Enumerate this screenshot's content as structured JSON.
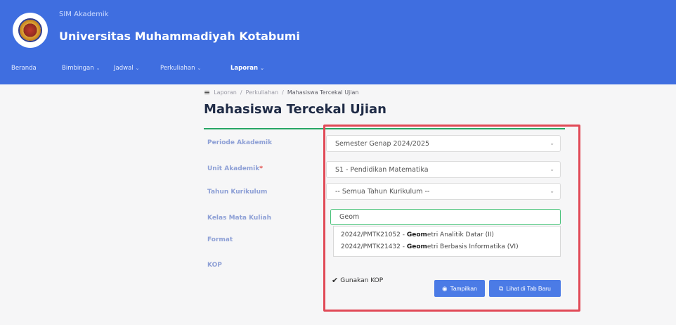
{
  "header": {
    "subtitle": "SIM Akademik",
    "title": "Universitas Muhammadiyah Kotabumi",
    "color": "#3f6ee0"
  },
  "nav": {
    "items": [
      {
        "label": "Beranda"
      },
      {
        "label": "Bimbingan"
      },
      {
        "label": "Jadwal"
      },
      {
        "label": "Perkuliahan"
      },
      {
        "label": "Laporan"
      }
    ]
  },
  "breadcrumb": {
    "items": [
      "Laporan",
      "Perkuliahan",
      "Mahasiswa Tercekal Ujian"
    ]
  },
  "page": {
    "title": "Mahasiswa Tercekal Ujian"
  },
  "form": {
    "periode": {
      "label": "Periode Akademik",
      "value": "Semester Genap 2024/2025"
    },
    "unit": {
      "label": "Unit Akademik",
      "required_mark": "*",
      "value": "S1 - Pendidikan Matematika"
    },
    "tahun": {
      "label": "Tahun Kurikulum",
      "value": "-- Semua Tahun Kurikulum --"
    },
    "kelas": {
      "label": "Kelas Mata Kuliah",
      "value": "Geom"
    },
    "format": {
      "label": "Format"
    },
    "kop": {
      "label": "KOP",
      "checkbox_label": "Gunakan KOP",
      "checked": true
    }
  },
  "dropdown": {
    "options": [
      {
        "prefix": "20242/PMTK21052 - ",
        "match": "Geom",
        "rest": "etri Analitik Datar (II)"
      },
      {
        "prefix": "20242/PMTK21432 - ",
        "match": "Geom",
        "rest": "etri Berbasis Informatika (VI)"
      }
    ]
  },
  "buttons": {
    "tampilkan": "Tampilkan",
    "lihat": "Lihat di Tab Baru"
  },
  "colors": {
    "accent": "#4b7be6",
    "highlight": "#e14a57",
    "divider": "#27a664"
  }
}
